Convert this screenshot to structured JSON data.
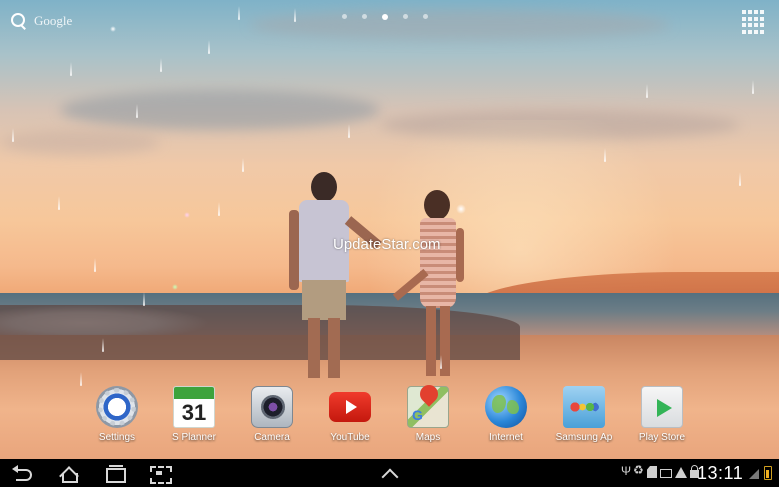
{
  "home": {
    "search": {
      "label": "Google",
      "icon": "search-icon"
    },
    "page_indicator": {
      "count": 5,
      "active_index": 2
    },
    "apps_button": {
      "icon": "apps-grid-icon"
    },
    "watermark": "UpdateStar.com"
  },
  "dock": {
    "apps": [
      {
        "label": "Settings",
        "icon": "settings-icon"
      },
      {
        "label": "S Planner",
        "icon": "calendar-icon",
        "date": "31"
      },
      {
        "label": "Camera",
        "icon": "camera-icon"
      },
      {
        "label": "YouTube",
        "icon": "youtube-icon"
      },
      {
        "label": "Maps",
        "icon": "maps-icon"
      },
      {
        "label": "Internet",
        "icon": "globe-icon"
      },
      {
        "label": "Samsung Ap",
        "icon": "samsung-apps-icon"
      },
      {
        "label": "Play Store",
        "icon": "play-store-icon"
      }
    ]
  },
  "navbar": {
    "buttons": [
      "back-icon",
      "home-icon",
      "recent-apps-icon",
      "screenshot-icon",
      "up-arrow-icon"
    ],
    "status_icons": [
      "usb-icon",
      "recycle-icon",
      "sd-card-icon",
      "mail-icon",
      "warning-icon",
      "lock-icon"
    ],
    "clock": "13:11",
    "signal": "signal-icon",
    "battery": "battery-charging-icon"
  },
  "colors": {
    "navbar_bg": "#000000",
    "label_text": "#ffffff"
  }
}
